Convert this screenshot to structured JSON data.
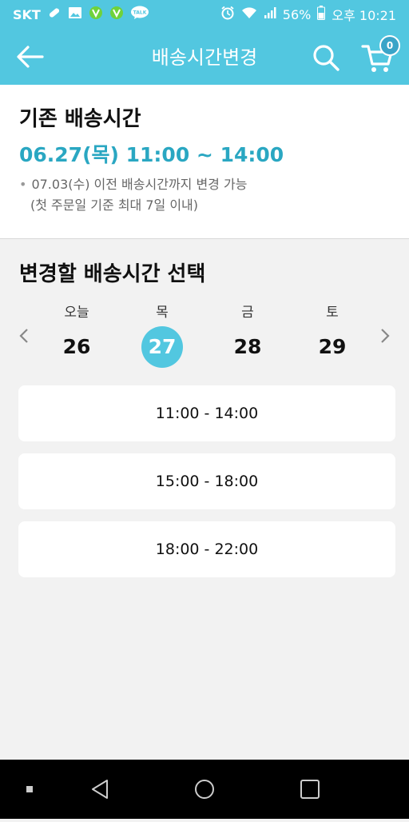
{
  "status": {
    "carrier": "SKT",
    "battery": "56%",
    "time": "오후 10:21",
    "icons": [
      "pill-icon",
      "image-icon",
      "v-app-icon",
      "v-app-icon",
      "talk-icon",
      "alarm-icon",
      "wifi-icon",
      "signal-icon",
      "battery-icon"
    ],
    "talk_label": "TALK"
  },
  "appbar": {
    "title": "배송시간변경",
    "cart_count": "0",
    "icons": [
      "back-arrow-icon",
      "search-icon",
      "cart-icon"
    ]
  },
  "current": {
    "title": "기존 배송시간",
    "time": "06.27(목) 11:00 ~ 14:00",
    "notice_line1": "07.03(수) 이전 배송시간까지 변경 가능",
    "notice_line2": "(첫 주문일 기준 최대 7일 이내)"
  },
  "select": {
    "title": "변경할 배송시간 선택",
    "days": [
      {
        "label": "오늘",
        "num": "26",
        "selected": false
      },
      {
        "label": "목",
        "num": "27",
        "selected": true
      },
      {
        "label": "금",
        "num": "28",
        "selected": false
      },
      {
        "label": "토",
        "num": "29",
        "selected": false
      }
    ],
    "slots": [
      "11:00 - 14:00",
      "15:00 - 18:00",
      "18:00 - 22:00"
    ],
    "icons": [
      "chevron-left-icon",
      "chevron-right-icon"
    ]
  },
  "colors": {
    "accent": "#52c7e0",
    "accent_text": "#2aa7c2",
    "background": "#f2f2f2"
  }
}
